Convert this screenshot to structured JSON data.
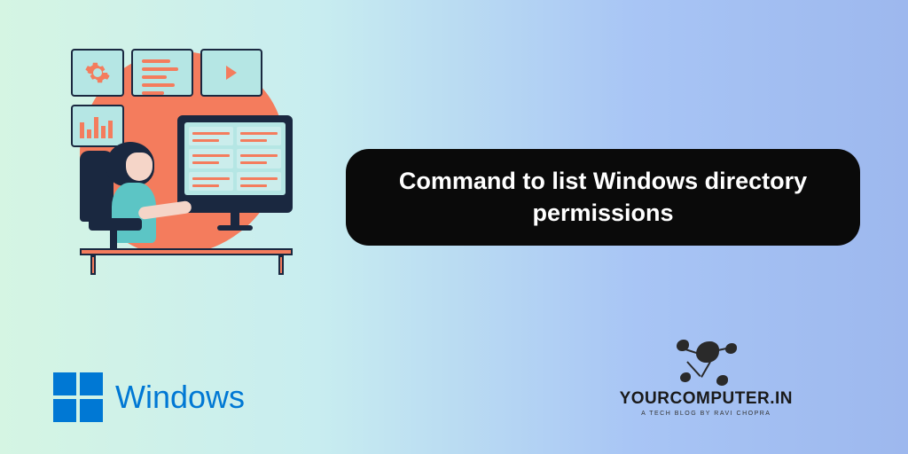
{
  "title": "Command to list Windows directory permissions",
  "windows": {
    "label": "Windows"
  },
  "site": {
    "name": "YOURCOMPUTER.IN",
    "tagline": "A TECH BLOG BY RAVI CHOPRA"
  }
}
